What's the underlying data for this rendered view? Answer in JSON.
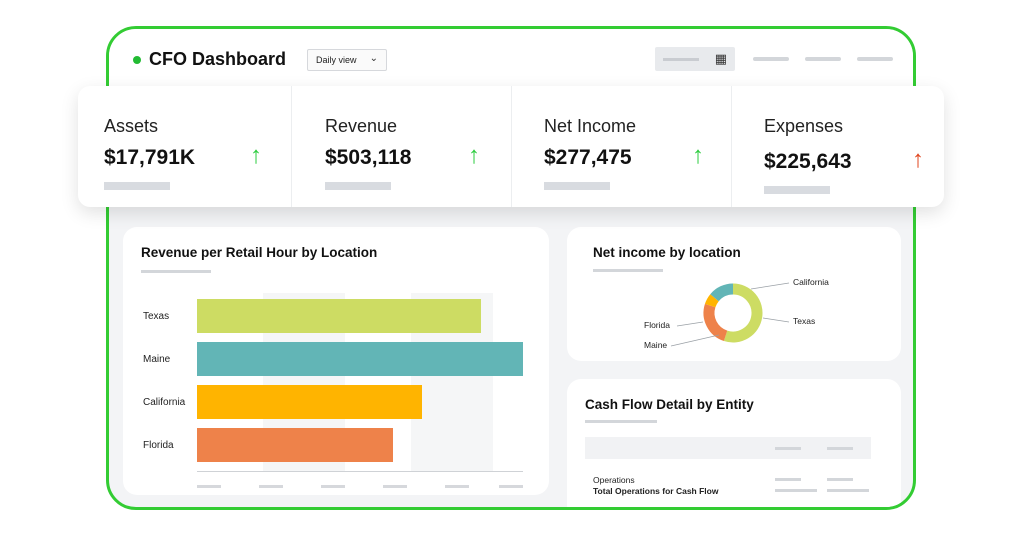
{
  "header": {
    "title": "CFO Dashboard",
    "view_select": "Daily view"
  },
  "kpis": [
    {
      "label": "Assets",
      "value": "$17,791K",
      "trend": "up"
    },
    {
      "label": "Revenue",
      "value": "$503,118",
      "trend": "up"
    },
    {
      "label": "Net Income",
      "value": "$277,475",
      "trend": "up"
    },
    {
      "label": "Expenses",
      "value": "$225,643",
      "trend": "down"
    }
  ],
  "revenue_card": {
    "title": "Revenue per Retail Hour by Location"
  },
  "net_income_card": {
    "title": "Net income by location"
  },
  "cashflow_card": {
    "title": "Cash Flow Detail by Entity",
    "row_label": "Operations",
    "row_total": "Total Operations for Cash Flow"
  },
  "colors": {
    "accent": "#33cc33",
    "up": "#2ecc40",
    "down": "#e0461f"
  },
  "chart_data": [
    {
      "type": "bar",
      "orientation": "horizontal",
      "title": "Revenue per Retail Hour by Location",
      "categories": [
        "Texas",
        "Maine",
        "California",
        "Florida"
      ],
      "values": [
        87,
        100,
        69,
        60
      ],
      "colors": [
        "#cddc63",
        "#62b5b6",
        "#ffb400",
        "#ee824a"
      ],
      "xlim": [
        0,
        100
      ],
      "grid": false
    },
    {
      "type": "pie",
      "style": "donut",
      "title": "Net income by location",
      "categories": [
        "California",
        "Texas",
        "Maine",
        "Florida"
      ],
      "values": [
        55,
        25,
        6,
        14
      ],
      "colors": [
        "#cddc63",
        "#ee824a",
        "#ffb400",
        "#62b5b6"
      ]
    }
  ]
}
